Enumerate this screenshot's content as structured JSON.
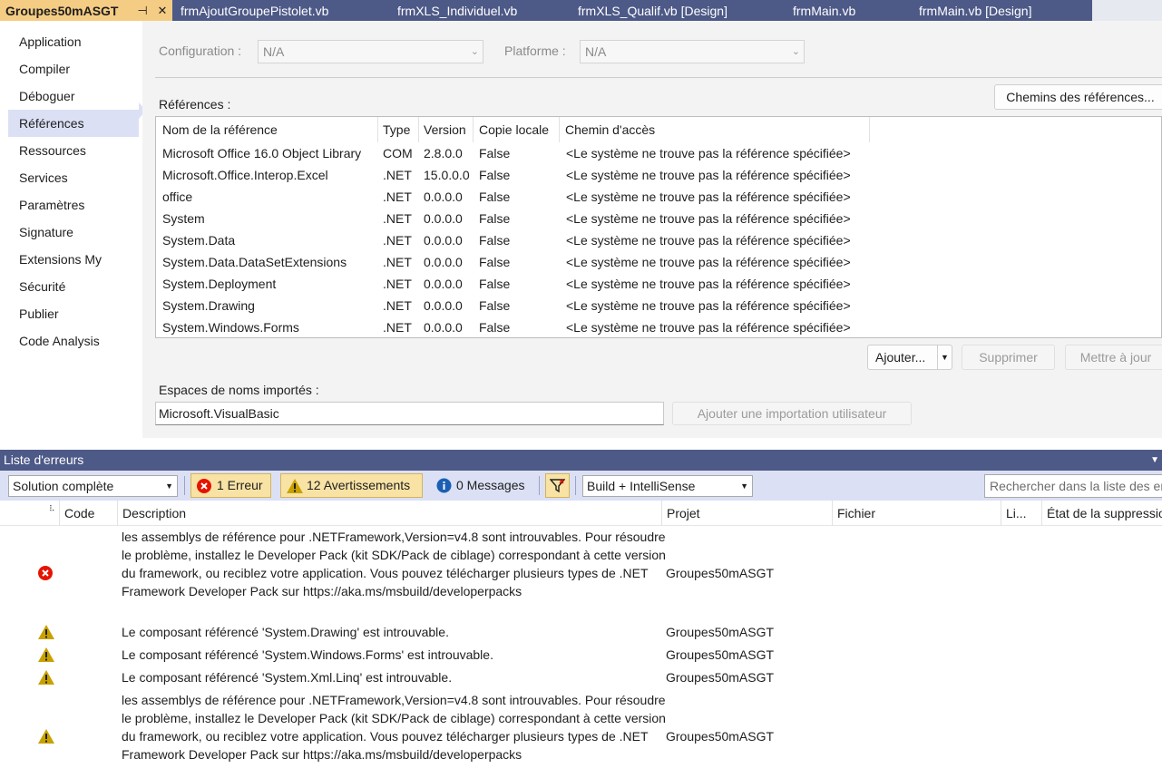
{
  "tabs": [
    {
      "label": "Groupes50mASGT",
      "active": true
    },
    {
      "label": "frmAjoutGroupePistolet.vb"
    },
    {
      "label": "frmXLS_Individuel.vb"
    },
    {
      "label": "frmXLS_Qualif.vb [Design]"
    },
    {
      "label": "frmMain.vb"
    },
    {
      "label": "frmMain.vb [Design]"
    }
  ],
  "nav": {
    "items": [
      "Application",
      "Compiler",
      "Déboguer",
      "Références",
      "Ressources",
      "Services",
      "Paramètres",
      "Signature",
      "Extensions My",
      "Sécurité",
      "Publier",
      "Code Analysis"
    ],
    "selected": "Références"
  },
  "config": {
    "configuration_label": "Configuration :",
    "configuration_value": "N/A",
    "platform_label": "Platforme :",
    "platform_value": "N/A"
  },
  "references": {
    "label": "Références :",
    "paths_button": "Chemins des références...",
    "columns": [
      "Nom de la référence",
      "Type",
      "Version",
      "Copie locale",
      "Chemin d'accès"
    ],
    "rows": [
      {
        "name": "Microsoft Office 16.0 Object Library",
        "type": "COM",
        "version": "2.8.0.0",
        "copy": "False",
        "path": "<Le système ne trouve pas la référence spécifiée>"
      },
      {
        "name": "Microsoft.Office.Interop.Excel",
        "type": ".NET",
        "version": "15.0.0.0",
        "copy": "False",
        "path": "<Le système ne trouve pas la référence spécifiée>"
      },
      {
        "name": "office",
        "type": ".NET",
        "version": "0.0.0.0",
        "copy": "False",
        "path": "<Le système ne trouve pas la référence spécifiée>"
      },
      {
        "name": "System",
        "type": ".NET",
        "version": "0.0.0.0",
        "copy": "False",
        "path": "<Le système ne trouve pas la référence spécifiée>"
      },
      {
        "name": "System.Data",
        "type": ".NET",
        "version": "0.0.0.0",
        "copy": "False",
        "path": "<Le système ne trouve pas la référence spécifiée>"
      },
      {
        "name": "System.Data.DataSetExtensions",
        "type": ".NET",
        "version": "0.0.0.0",
        "copy": "False",
        "path": "<Le système ne trouve pas la référence spécifiée>"
      },
      {
        "name": "System.Deployment",
        "type": ".NET",
        "version": "0.0.0.0",
        "copy": "False",
        "path": "<Le système ne trouve pas la référence spécifiée>"
      },
      {
        "name": "System.Drawing",
        "type": ".NET",
        "version": "0.0.0.0",
        "copy": "False",
        "path": "<Le système ne trouve pas la référence spécifiée>"
      },
      {
        "name": "System.Windows.Forms",
        "type": ".NET",
        "version": "0.0.0.0",
        "copy": "False",
        "path": "<Le système ne trouve pas la référence spécifiée>"
      }
    ],
    "add_button": "Ajouter...",
    "remove_button": "Supprimer",
    "update_button": "Mettre à jour"
  },
  "imports": {
    "label": "Espaces de noms importés :",
    "value": "Microsoft.VisualBasic",
    "add_button": "Ajouter une importation utilisateur"
  },
  "error_list": {
    "title": "Liste d'erreurs",
    "scope": "Solution complète",
    "errors_label": "1 Erreur",
    "warnings_label": "12 Avertissements",
    "messages_label": "0 Messages",
    "build_filter": "Build + IntelliSense",
    "search_placeholder": "Rechercher dans la liste des erreurs",
    "columns": [
      "Code",
      "Description",
      "Projet",
      "Fichier",
      "Li...",
      "État de la suppression"
    ],
    "rows": [
      {
        "severity": "error",
        "description": "les assemblys de référence pour .NETFramework,Version=v4.8 sont introuvables. Pour résoudre le problème, installez le Developer Pack (kit SDK/Pack de ciblage) correspondant à cette version du framework, ou reciblez votre application. Vous pouvez télécharger plusieurs types de .NET Framework Developer Pack sur https://aka.ms/msbuild/developerpacks",
        "project": "Groupes50mASGT"
      },
      {
        "severity": "warning",
        "description": "Le composant référencé 'System.Drawing' est introuvable.",
        "project": "Groupes50mASGT"
      },
      {
        "severity": "warning",
        "description": "Le composant référencé 'System.Windows.Forms' est introuvable.",
        "project": "Groupes50mASGT"
      },
      {
        "severity": "warning",
        "description": "Le composant référencé 'System.Xml.Linq' est introuvable.",
        "project": "Groupes50mASGT"
      },
      {
        "severity": "warning",
        "description": "les assemblys de référence pour .NETFramework,Version=v4.8 sont introuvables. Pour résoudre le problème, installez le Developer Pack (kit SDK/Pack de ciblage) correspondant à cette version du framework, ou reciblez votre application. Vous pouvez télécharger plusieurs types de .NET Framework Developer Pack sur https://aka.ms/msbuild/developerpacks",
        "project": "Groupes50mASGT"
      }
    ]
  },
  "colors": {
    "tab_strip": "#4d5987",
    "active_tab": "#f5cc84",
    "selection": "#dbe0f5",
    "error_red": "#e51400",
    "warning_yellow": "#c8a100"
  }
}
